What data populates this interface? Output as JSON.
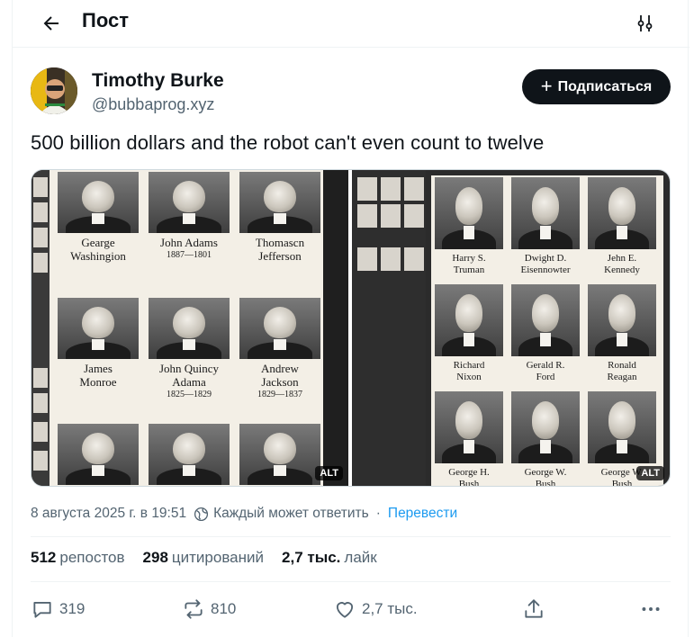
{
  "header": {
    "title": "Пост",
    "back_icon": "arrow-left-icon",
    "tune_icon": "sliders-icon"
  },
  "author": {
    "name": "Timothy Burke",
    "handle": "@bubbaprog.xyz",
    "follow_label": "Подписаться"
  },
  "post": {
    "text": "500 billion dollars and the robot can't even count to twelve",
    "media": [
      {
        "alt_label": "ALT",
        "captions": [
          {
            "name": "Gearge\nWashingion",
            "years": ""
          },
          {
            "name": "John Adams",
            "years": "1887—1801"
          },
          {
            "name": "Thomascn\nJefferson",
            "years": ""
          },
          {
            "name": "James\nMonroe",
            "years": ""
          },
          {
            "name": "John Quincy\nAdama",
            "years": "1825—1829"
          },
          {
            "name": "Andrew\nJackson",
            "years": "1829—1837"
          }
        ]
      },
      {
        "alt_label": "ALT",
        "captions": [
          {
            "name": "Harry S.\nTruman",
            "years": ""
          },
          {
            "name": "Dwight D.\nEisennowter",
            "years": ""
          },
          {
            "name": "Jehn E.\nKennedy",
            "years": ""
          },
          {
            "name": "Richard\nNixon",
            "years": ""
          },
          {
            "name": "Gerald R.\nFord",
            "years": ""
          },
          {
            "name": "Ronald\nReagan",
            "years": ""
          },
          {
            "name": "George H.\nBush",
            "years": ""
          },
          {
            "name": "George W.\nBush",
            "years": ""
          },
          {
            "name": "George W.\nBush",
            "years": ""
          }
        ]
      }
    ],
    "timestamp": "8 августа 2025 г. в 19:51",
    "reply_setting": "Каждый может ответить",
    "translate_label": "Перевести"
  },
  "stats": {
    "reposts_count": "512",
    "reposts_label": "репостов",
    "quotes_count": "298",
    "quotes_label": "цитирований",
    "likes_count": "2,7 тыс.",
    "likes_label": "лайк"
  },
  "actions": {
    "replies": "319",
    "reposts": "810",
    "likes": "2,7 тыс."
  },
  "colors": {
    "accent": "#1d9bf0",
    "text": "#0f1419",
    "muted": "#536471",
    "follow_bg": "#0f1419"
  }
}
